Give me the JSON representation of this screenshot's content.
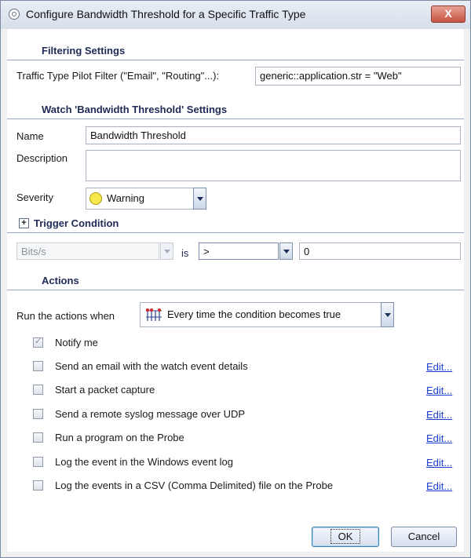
{
  "window": {
    "title": "Configure Bandwidth Threshold for a Specific Traffic Type",
    "close_label": "X"
  },
  "filtering": {
    "header": "Filtering Settings",
    "filter_label": "Traffic Type Pilot Filter (\"Email\", \"Routing\"...):",
    "filter_value": "generic::application.str = \"Web\""
  },
  "watch": {
    "header": "Watch 'Bandwidth Threshold' Settings",
    "name_label": "Name",
    "name_value": "Bandwidth Threshold",
    "description_label": "Description",
    "description_value": "",
    "severity_label": "Severity",
    "severity_value": "Warning"
  },
  "trigger": {
    "header": "Trigger Condition",
    "expand_symbol": "+",
    "metric": "Bits/s",
    "is_label": "is",
    "operator": ">",
    "value": "0"
  },
  "actions": {
    "header": "Actions",
    "run_label": "Run the actions when",
    "run_value": "Every time the condition becomes true",
    "notify_label": "Notify me",
    "items": [
      {
        "label": "Send an email with the watch event details",
        "edit": "Edit..."
      },
      {
        "label": "Start a packet capture",
        "edit": "Edit..."
      },
      {
        "label": "Send a remote syslog message over UDP",
        "edit": "Edit..."
      },
      {
        "label": "Run a program on the Probe",
        "edit": "Edit..."
      },
      {
        "label": "Log the event in the Windows event log",
        "edit": "Edit..."
      },
      {
        "label": "Log the events in a CSV (Comma Delimited) file on the Probe",
        "edit": "Edit..."
      }
    ]
  },
  "buttons": {
    "ok": "OK",
    "cancel": "Cancel"
  },
  "colors": {
    "header_text": "#1f2a55",
    "link": "#1a3fcf",
    "warning_icon": "#f6e84a",
    "close_button": "#c75442"
  }
}
